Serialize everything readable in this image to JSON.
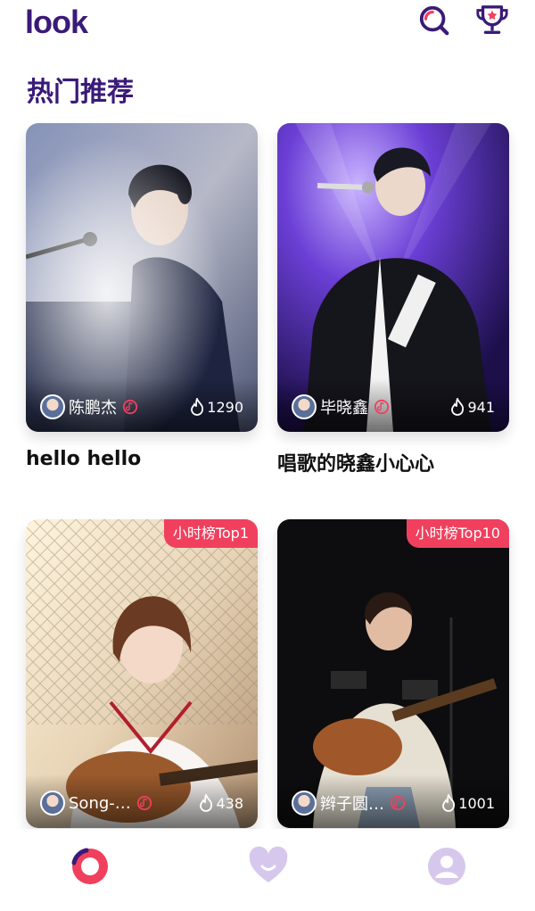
{
  "app": {
    "logo": "look"
  },
  "header": {
    "search_icon": "search-icon",
    "trophy_icon": "trophy-icon"
  },
  "section": {
    "title": "热门推荐"
  },
  "cards": [
    {
      "singer": "陈鹏杰",
      "heat": "1290",
      "title": "hello hello",
      "badge": ""
    },
    {
      "singer": "毕晓鑫",
      "heat": "941",
      "title": "唱歌的晓鑫小心心",
      "badge": ""
    },
    {
      "singer": "Song-…",
      "heat": "438",
      "title": "",
      "badge": "小时榜Top1"
    },
    {
      "singer": "辫子圆…",
      "heat": "1001",
      "title": "",
      "badge": "小时榜Top10"
    }
  ],
  "bottom_nav": {
    "items": [
      {
        "icon": "discover-icon",
        "active": true
      },
      {
        "icon": "heart-icon",
        "active": false
      },
      {
        "icon": "profile-icon",
        "active": false
      }
    ]
  },
  "colors": {
    "brand": "#3a1a78",
    "accent": "#f0405e",
    "inactive": "#d6c8ec"
  }
}
